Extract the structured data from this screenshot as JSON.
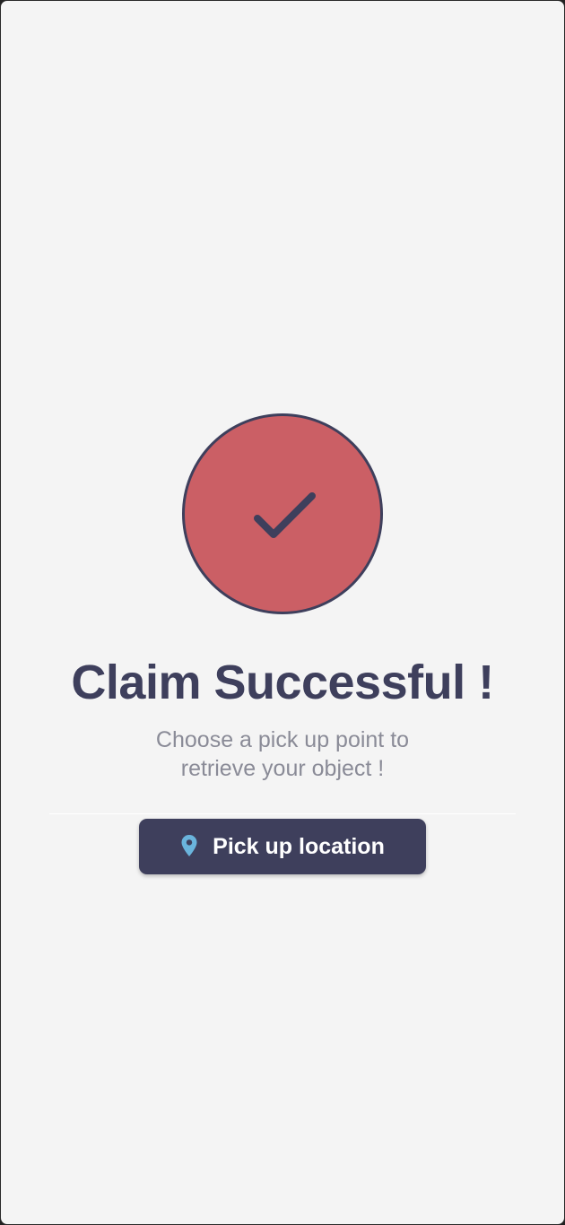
{
  "success": {
    "icon": "checkmark-icon",
    "title": "Claim Successful !",
    "subtitle": "Choose a pick up point to retrieve your object !"
  },
  "action": {
    "icon": "map-pin-icon",
    "label": "Pick up location"
  },
  "colors": {
    "background": "#f4f4f4",
    "circle_fill": "#cb5f65",
    "primary": "#3e3f5c",
    "subtitle": "#8a8b97",
    "pin": "#6ab4dc"
  }
}
